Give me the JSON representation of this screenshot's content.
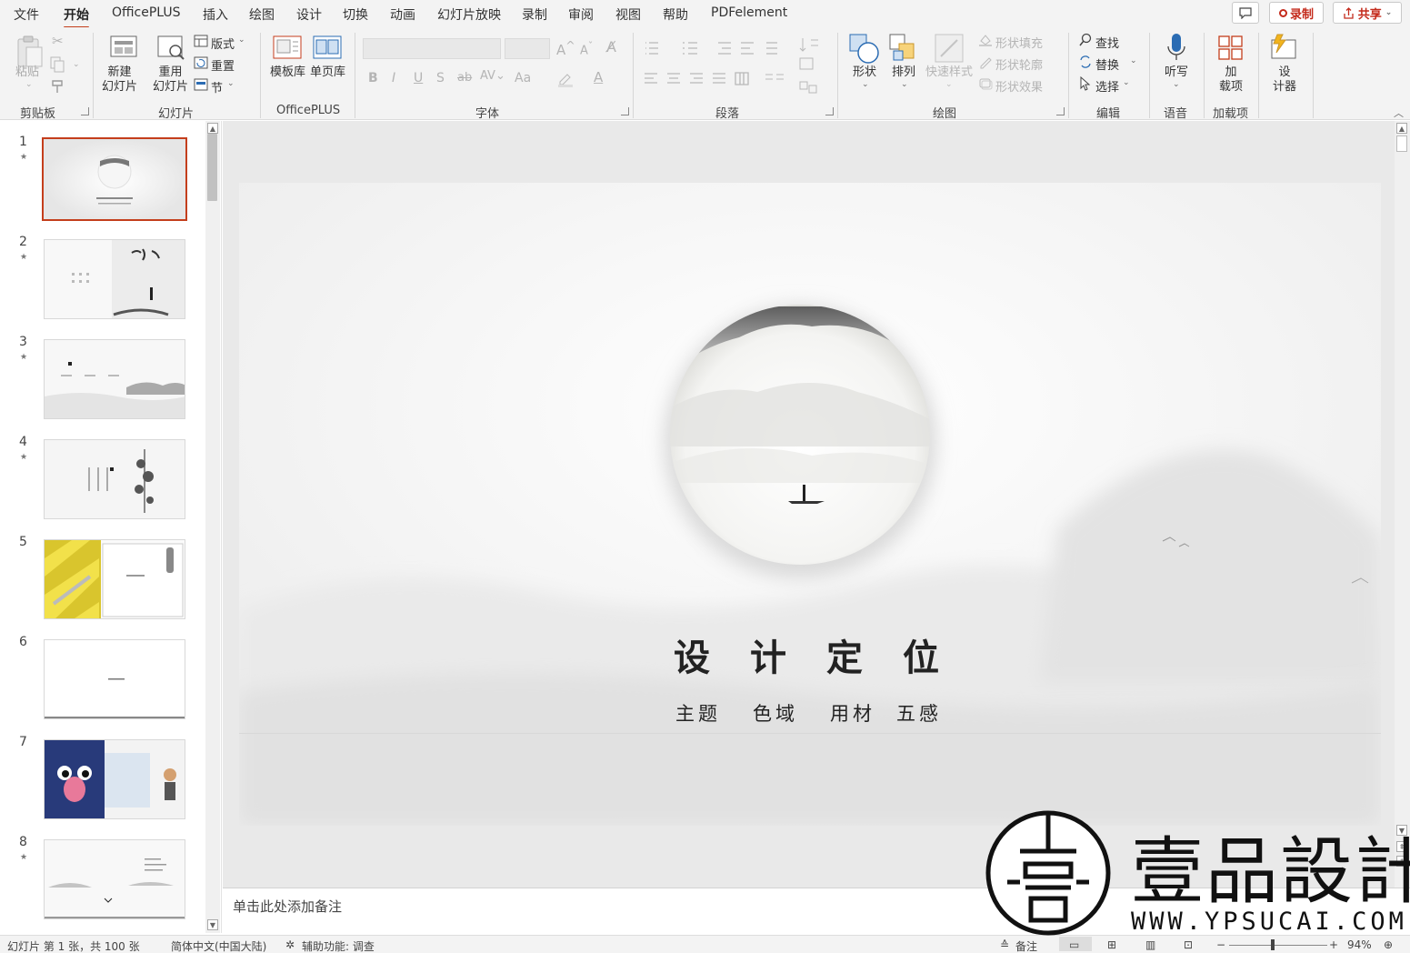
{
  "menu": {
    "tabs": [
      "文件",
      "开始",
      "OfficePLUS",
      "插入",
      "绘图",
      "设计",
      "切换",
      "动画",
      "幻灯片放映",
      "录制",
      "审阅",
      "视图",
      "帮助",
      "PDFelement"
    ],
    "active_tab": "开始",
    "record_label": "录制",
    "share_label": "共享"
  },
  "ribbon": {
    "clipboard": {
      "paste": "粘贴",
      "group": "剪贴板"
    },
    "slides": {
      "new_slide": "新建\n幻灯片",
      "reuse": "重用\n幻灯片",
      "layout": "版式",
      "reset": "重置",
      "section": "节",
      "group": "幻灯片"
    },
    "officeplus": {
      "template_lib": "模板库",
      "single_page_lib": "单页库",
      "group": "OfficePLUS"
    },
    "font": {
      "group": "字体",
      "bold": "B",
      "italic": "I",
      "underline": "U",
      "strike": "S",
      "case": "Aa"
    },
    "paragraph": {
      "group": "段落"
    },
    "drawing": {
      "shapes": "形状",
      "arrange": "排列",
      "quick_styles": "快速样式",
      "fill": "形状填充",
      "outline": "形状轮廓",
      "effects": "形状效果",
      "group": "绘图"
    },
    "editing": {
      "find": "查找",
      "replace": "替换",
      "select": "选择",
      "group": "编辑"
    },
    "voice": {
      "dictate": "听写",
      "group": "语音"
    },
    "addins": {
      "addins": "加\n载项",
      "group": "加载项"
    },
    "designer": {
      "label": "设\n计器"
    }
  },
  "thumbnails": {
    "slides": [
      {
        "number": "1",
        "starred": true
      },
      {
        "number": "2",
        "starred": true
      },
      {
        "number": "3",
        "starred": true
      },
      {
        "number": "4",
        "starred": true
      },
      {
        "number": "5",
        "starred": false
      },
      {
        "number": "6",
        "starred": false
      },
      {
        "number": "7",
        "starred": false
      },
      {
        "number": "8",
        "starred": true
      }
    ],
    "selected": 1
  },
  "slide": {
    "title_chars": [
      "设",
      "计",
      "定",
      "位"
    ],
    "subtitles": [
      "主题",
      "色域",
      "用材",
      "五感"
    ]
  },
  "notes": {
    "placeholder": "单击此处添加备注"
  },
  "status": {
    "slide_position": "幻灯片 第 1 张，共 100 张",
    "language": "简体中文(中国大陆)",
    "accessibility": "辅助功能: 调查",
    "notes_btn": "备注",
    "zoom": "94%"
  },
  "watermark": {
    "brand": "壹品設計",
    "url": "WWW.YPSUCAI.COM"
  },
  "colors": {
    "accent": "#c43e1c",
    "ribbon_bg": "#f3f3f3",
    "editor_bg": "#e9e9e9"
  }
}
